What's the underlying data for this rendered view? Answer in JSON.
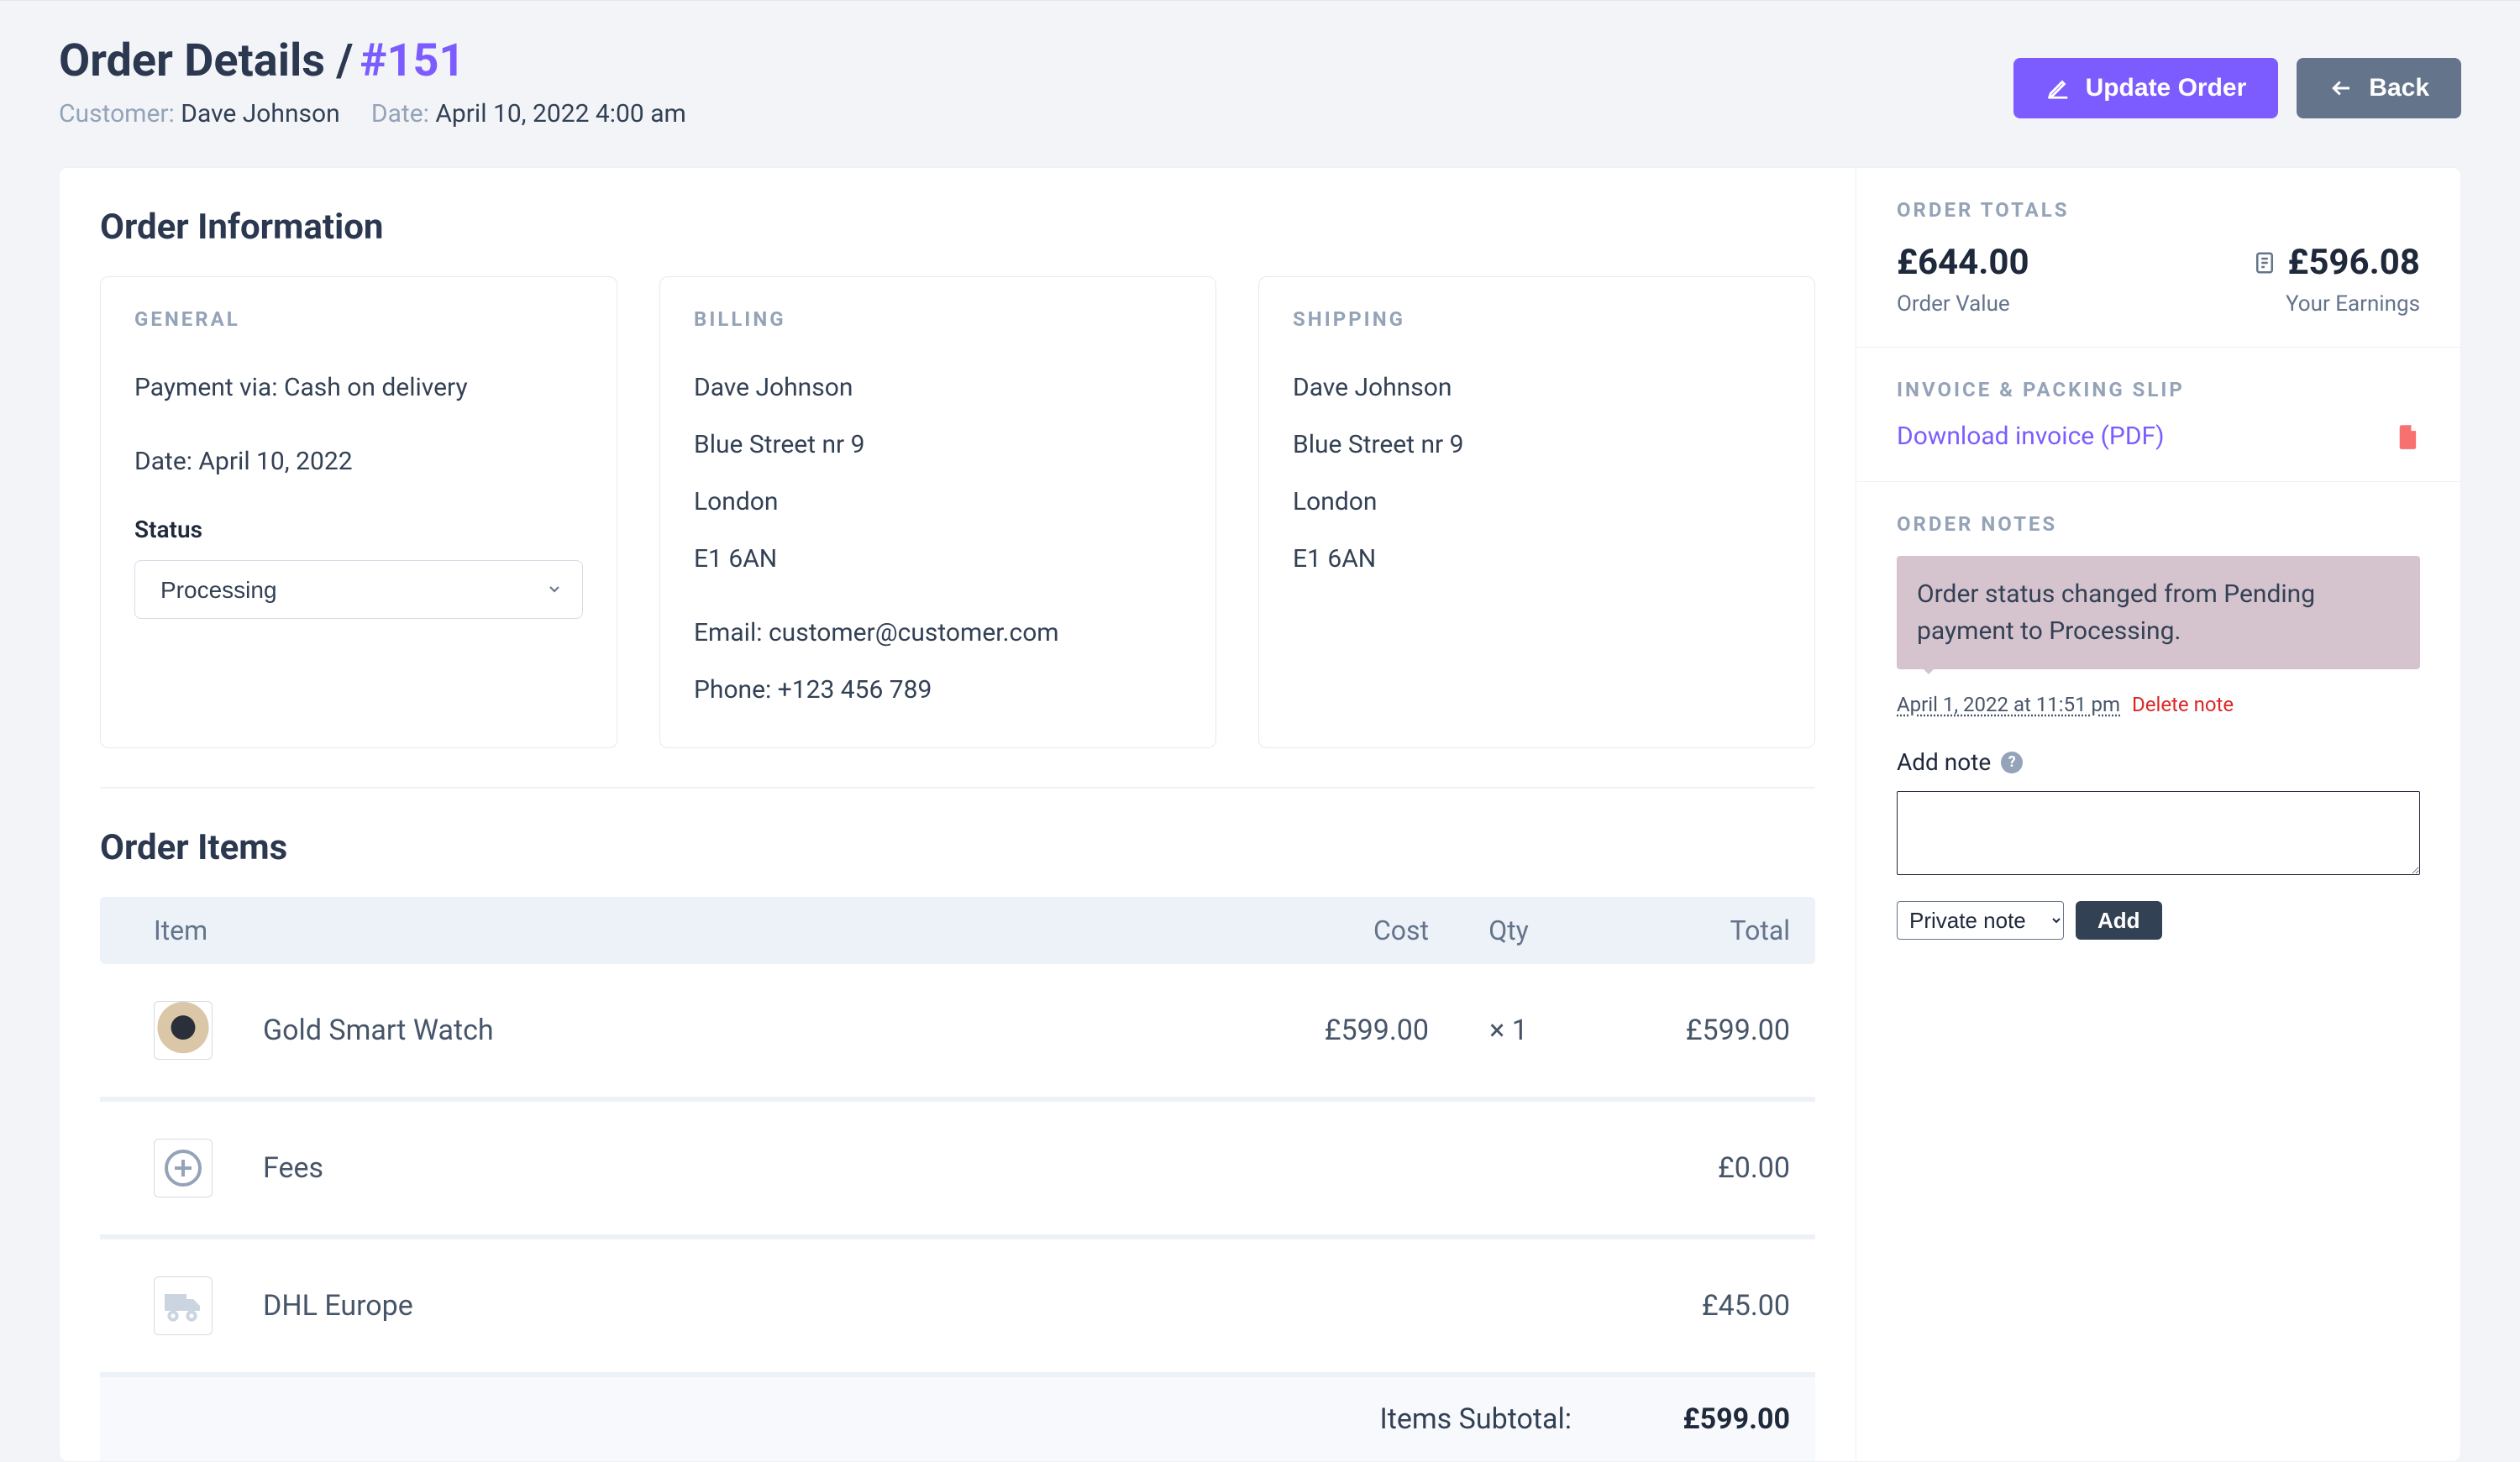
{
  "header": {
    "title": "Order Details /",
    "order_number": "#151",
    "customer_label": "Customer:",
    "customer_name": "Dave Johnson",
    "date_label": "Date:",
    "date_value": "April 10, 2022 4:00 am",
    "update_btn": "Update Order",
    "back_btn": "Back"
  },
  "order_info": {
    "section_title": "Order Information",
    "general": {
      "head": "General",
      "payment_line": "Payment via: Cash on delivery",
      "date_line": "Date: April 10, 2022",
      "status_label": "Status",
      "status_value": "Processing"
    },
    "billing": {
      "head": "Billing",
      "name": "Dave Johnson",
      "line1": "Blue Street nr 9",
      "city": "London",
      "postcode": "E1 6AN",
      "email_line": "Email: customer@customer.com",
      "phone_line": "Phone: +123 456 789"
    },
    "shipping": {
      "head": "Shipping",
      "name": "Dave Johnson",
      "line1": "Blue Street nr 9",
      "city": "London",
      "postcode": "E1 6AN"
    }
  },
  "items": {
    "section_title": "Order Items",
    "columns": {
      "item": "Item",
      "cost": "Cost",
      "qty": "Qty",
      "total": "Total"
    },
    "rows": [
      {
        "name": "Gold Smart Watch",
        "cost": "£599.00",
        "qty": "× 1",
        "total": "£599.00",
        "kind": "watch"
      },
      {
        "name": "Fees",
        "cost": "",
        "qty": "",
        "total": "£0.00",
        "kind": "plus"
      },
      {
        "name": "DHL Europe",
        "cost": "",
        "qty": "",
        "total": "£45.00",
        "kind": "truck"
      }
    ],
    "subtotal_label": "Items Subtotal:",
    "subtotal_value": "£599.00"
  },
  "side": {
    "totals": {
      "head": "Order Totals",
      "order_value_amount": "£644.00",
      "order_value_label": "Order Value",
      "earnings_amount": "£596.08",
      "earnings_label": "Your Earnings"
    },
    "invoice": {
      "head": "Invoice & Packing Slip",
      "download_label": "Download invoice (PDF)"
    },
    "notes": {
      "head": "Order Notes",
      "bubble": "Order status changed from Pending payment to Processing.",
      "timestamp": "April 1, 2022 at 11:51 pm",
      "delete": "Delete note",
      "add_label": "Add note",
      "note_type": "Private note",
      "add_btn": "Add"
    }
  }
}
